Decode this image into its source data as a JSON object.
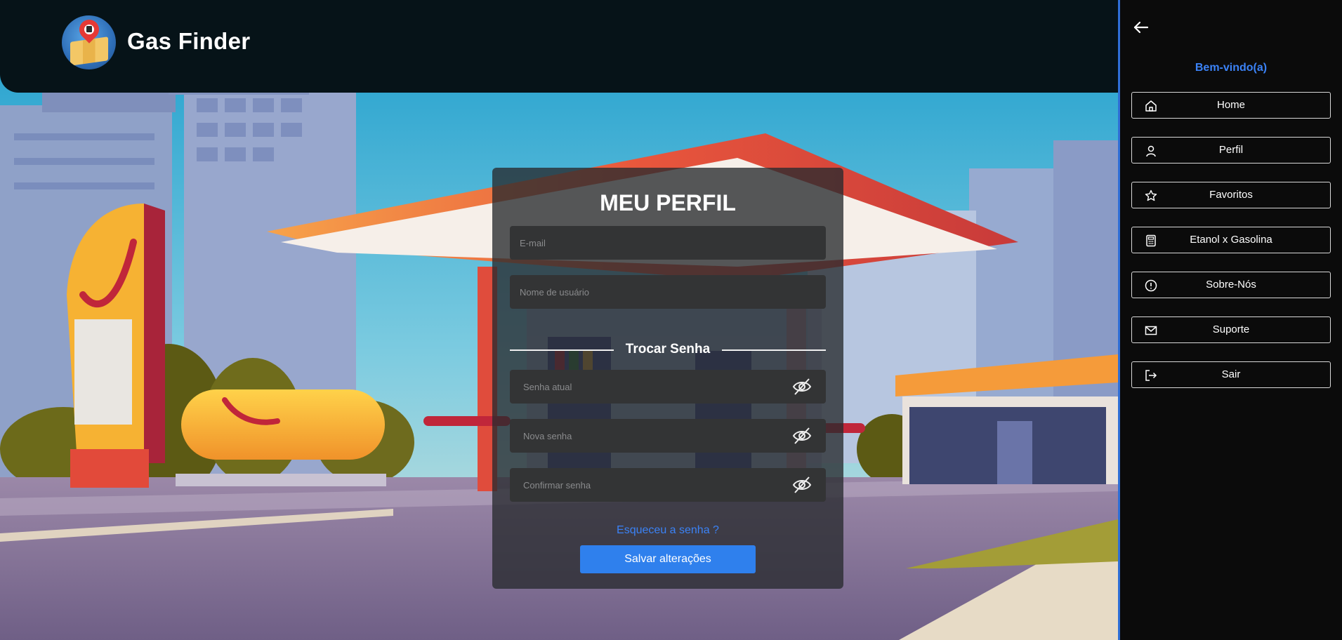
{
  "app": {
    "title": "Gas Finder",
    "logo_icon": "gas-finder-map-pin-logo"
  },
  "form": {
    "title": "MEU PERFIL",
    "email_placeholder": "E-mail",
    "username_placeholder": "Nome de usuário",
    "password_section_title": "Trocar Senha",
    "current_password_placeholder": "Senha atual",
    "new_password_placeholder": "Nova senha",
    "confirm_password_placeholder": "Confirmar senha",
    "password_toggle_icon": "eye-off-icon",
    "forgot_link": "Esqueceu a senha ?",
    "save_label": "Salvar alterações"
  },
  "sidebar": {
    "back_icon": "arrow-left-icon",
    "welcome": "Bem-vindo(a)",
    "items": [
      {
        "label": "Home",
        "icon": "home-icon"
      },
      {
        "label": "Perfil",
        "icon": "user-icon"
      },
      {
        "label": "Favoritos",
        "icon": "star-icon"
      },
      {
        "label": "Etanol x Gasolina",
        "icon": "calculator-icon"
      },
      {
        "label": "Sobre-Nós",
        "icon": "info-icon"
      },
      {
        "label": "Suporte",
        "icon": "mail-icon"
      },
      {
        "label": "Sair",
        "icon": "logout-icon"
      }
    ]
  },
  "colors": {
    "accent": "#3b82f6",
    "button": "#2f80ed",
    "header_bg": "#061318",
    "sidebar_bg": "#0b0b0b",
    "sidebar_border": "#2f6fd6"
  }
}
